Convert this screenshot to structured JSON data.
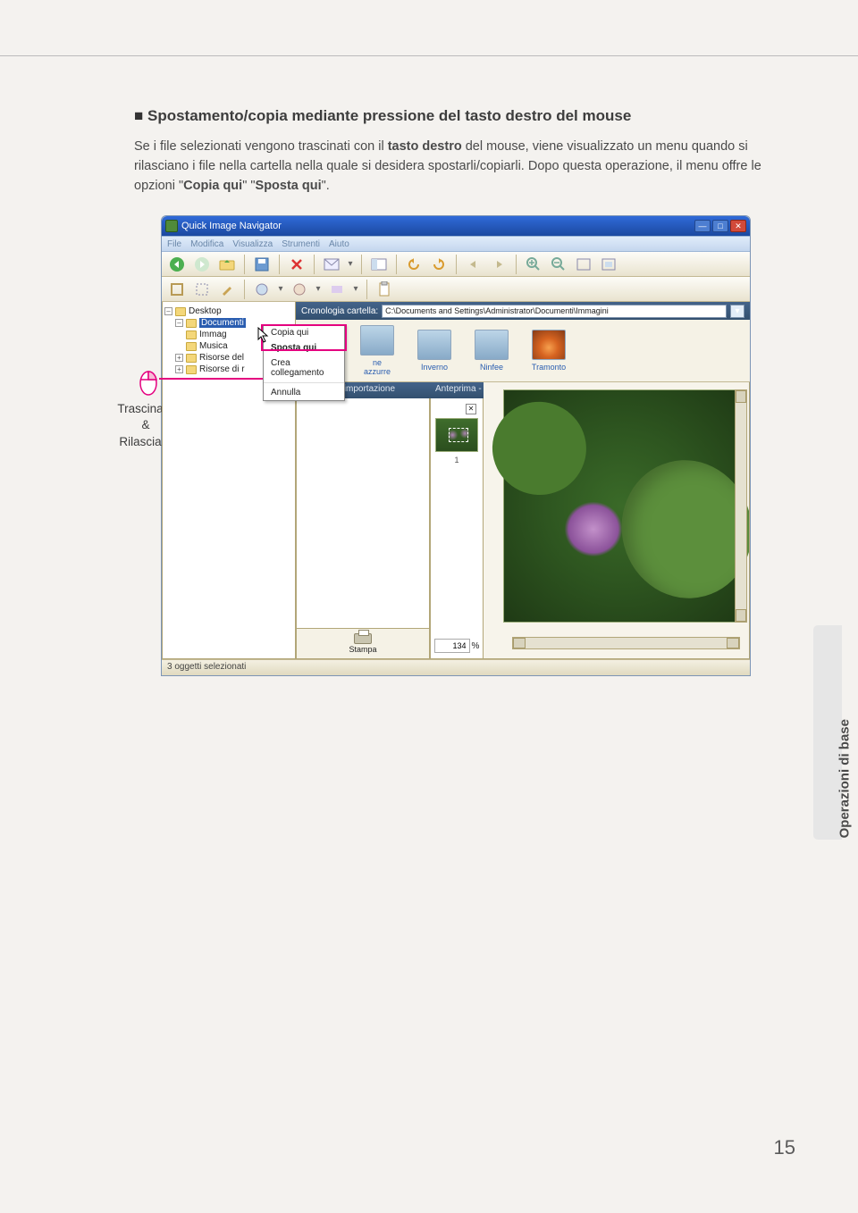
{
  "page": {
    "heading": "Spostamento/copia mediante pressione del tasto destro del mouse",
    "body_pre": "Se i file selezionati vengono trascinati con il ",
    "body_b1": "tasto destro",
    "body_mid": " del mouse, viene visualizzato un menu quando si rilasciano i file nella cartella nella quale si desidera spostarli/copiarli. Dopo questa operazione, il menu offre le opzioni \"",
    "body_b2": "Copia qui",
    "body_mid2": "\" \"",
    "body_b3": "Sposta qui",
    "body_post": "\".",
    "drag_label_l1": "Trascinare",
    "drag_label_amp": "&",
    "drag_label_l2": "Rilasciare",
    "side_tab": "Operazioni di base",
    "page_number": "15"
  },
  "app": {
    "title": "Quick Image Navigator",
    "menu": [
      "File",
      "Modifica",
      "Visualizza",
      "Strumenti",
      "Aiuto"
    ],
    "tree": {
      "desktop": "Desktop",
      "documenti": "Documenti",
      "immag": "Immag",
      "musica": "Musica",
      "risorse_del": "Risorse del",
      "risorse_di": "Risorse di r"
    },
    "ctx": {
      "copia": "Copia qui",
      "sposta": "Sposta qui",
      "crea": "Crea collegamento",
      "annulla": "Annulla"
    },
    "path_label": "Cronologia cartella:",
    "path_value": "C:\\Documents and Settings\\Administrator\\Documenti\\Immagini",
    "thumbs": {
      "t1": "ne azzurre",
      "t2": "Inverno",
      "t3": "Ninfee",
      "t4": "Tramonto"
    },
    "import_hdr": "Cartella di importazione",
    "preview_hdr": "Anteprima - [Ninfee.jpg]",
    "thumb_num": "1",
    "zoom_value": "134",
    "zoom_pct": "%",
    "print_label": "Stampa",
    "status": "3 oggetti selezionati"
  }
}
